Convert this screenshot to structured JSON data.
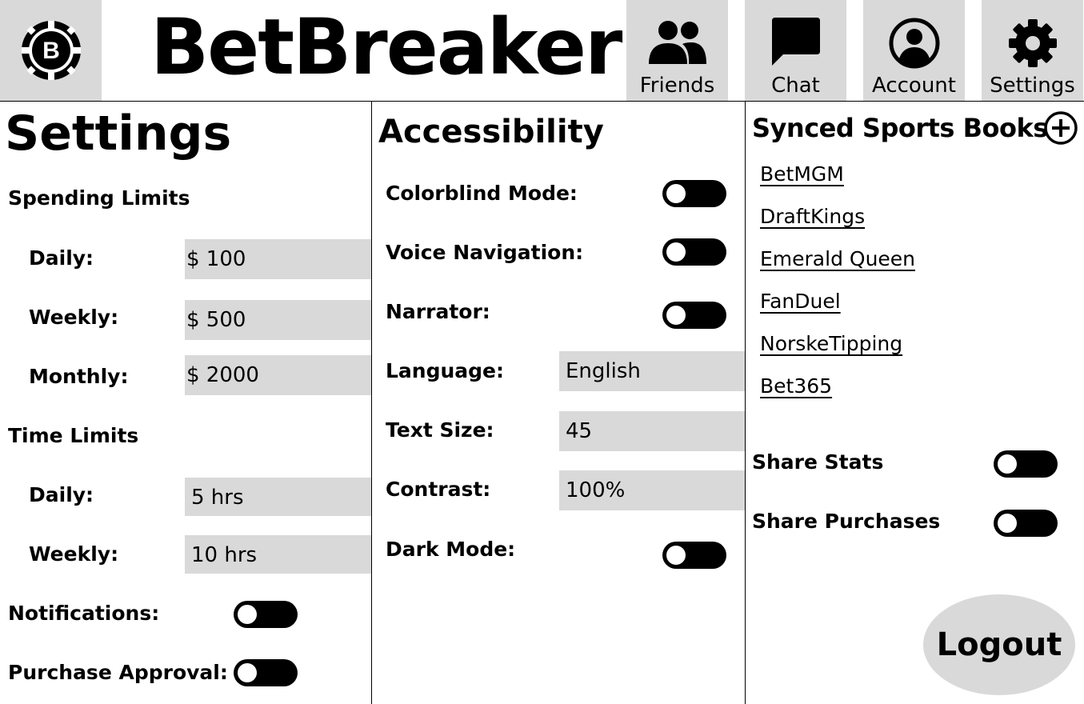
{
  "header": {
    "logo_icon": "poker-chip-icon",
    "logo_letter": "B",
    "brand": "BetBreaker",
    "nav": [
      {
        "label": "Friends",
        "icon": "friends-icon"
      },
      {
        "label": "Chat",
        "icon": "chat-icon"
      },
      {
        "label": "Account",
        "icon": "account-icon"
      },
      {
        "label": "Settings",
        "icon": "gear-icon"
      }
    ]
  },
  "settings": {
    "title": "Settings",
    "spending": {
      "title": "Spending Limits",
      "daily_label": "Daily:",
      "daily_value": "$ 100",
      "weekly_label": "Weekly:",
      "weekly_value": "$ 500",
      "monthly_label": "Monthly:",
      "monthly_value": "$ 2000"
    },
    "time": {
      "title": "Time Limits",
      "daily_label": "Daily:",
      "daily_value": "5 hrs",
      "weekly_label": "Weekly:",
      "weekly_value": "10 hrs"
    },
    "notifications_label": "Notifications:",
    "purchase_approval_label": "Purchase Approval:"
  },
  "accessibility": {
    "title": "Accessibility",
    "colorblind_label": "Colorblind Mode:",
    "voice_label": "Voice Navigation:",
    "narrator_label": "Narrator:",
    "language_label": "Language:",
    "language_value": "English",
    "text_size_label": "Text Size:",
    "text_size_value": "45",
    "contrast_label": "Contrast:",
    "contrast_value": "100%",
    "dark_mode_label": "Dark Mode:"
  },
  "books": {
    "title": "Synced Sports Books",
    "add_icon": "plus-circle-icon",
    "items": [
      "BetMGM",
      "DraftKings",
      "Emerald Queen",
      "FanDuel",
      "NorskeTipping",
      "Bet365"
    ],
    "share_stats_label": "Share Stats",
    "share_purchases_label": "Share Purchases",
    "logout_label": "Logout"
  },
  "colors": {
    "tile": "#d9d9d9",
    "ink": "#000000"
  }
}
